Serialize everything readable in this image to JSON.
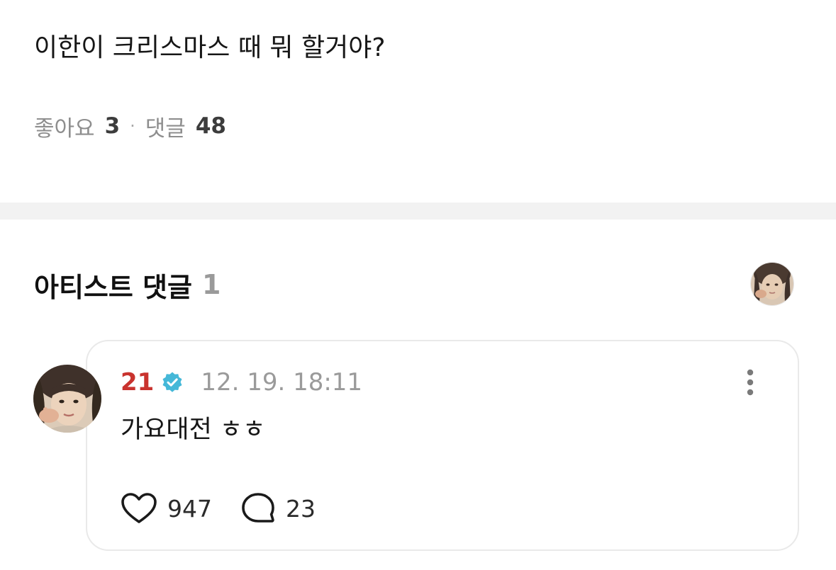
{
  "post": {
    "text": "이한이 크리스마스 때 뭐 할거야?",
    "likes_label": "좋아요",
    "likes_count": "3",
    "separator": "·",
    "comments_label": "댓글",
    "comments_count": "48"
  },
  "artist_comments": {
    "title": "아티스트 댓글",
    "count": "1"
  },
  "comment": {
    "author": "21",
    "timestamp": "12. 19. 18:11",
    "body": "가요대전 ㅎㅎ",
    "likes": "947",
    "replies": "23"
  },
  "colors": {
    "author_name": "#c9332e",
    "verified_badge": "#45b8d8",
    "divider": "#f2f2f2",
    "muted_text": "#9a9a9a"
  },
  "icons": {
    "verified": "verified-badge-icon",
    "more": "more-vertical-icon",
    "like": "heart-outline-icon",
    "reply": "speech-bubble-outline-icon"
  }
}
